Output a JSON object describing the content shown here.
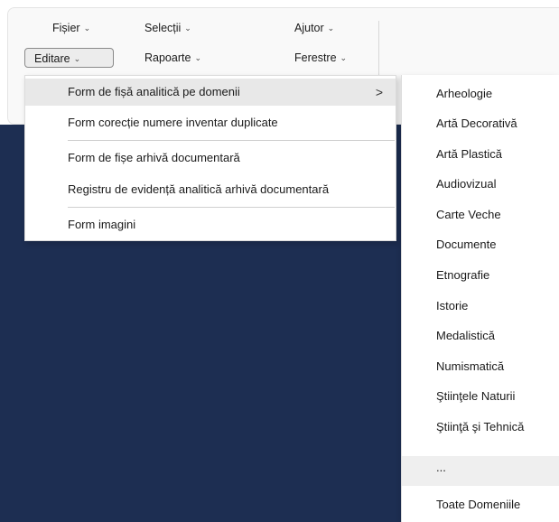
{
  "menubar": {
    "fisier": "Fișier",
    "selectii": "Selecții",
    "ajutor": "Ajutor",
    "editare": "Editare",
    "rapoarte": "Rapoarte",
    "ferestre": "Ferestre"
  },
  "dropdown": {
    "items": [
      "Form de fișă analitică pe domenii",
      "Form corecție numere inventar duplicate",
      "Form de fișe arhivă documentară",
      "Registru de evidență analitică arhivă documentară",
      "Form imagini"
    ],
    "submenu_arrow": ">"
  },
  "submenu": {
    "items": [
      "Arheologie",
      "Artă Decorativă",
      "Artă Plastică",
      "Audiovizual",
      "Carte Veche",
      "Documente",
      "Etnografie",
      "Istorie",
      "Medalistică",
      "Numismatică",
      "Ştiinţele Naturii",
      "Ştiinţă şi Tehnică",
      "...",
      "Toate Domeniile"
    ]
  },
  "colors": {
    "desktop": "#1d2e52",
    "highlight": "#e8e8e8"
  }
}
